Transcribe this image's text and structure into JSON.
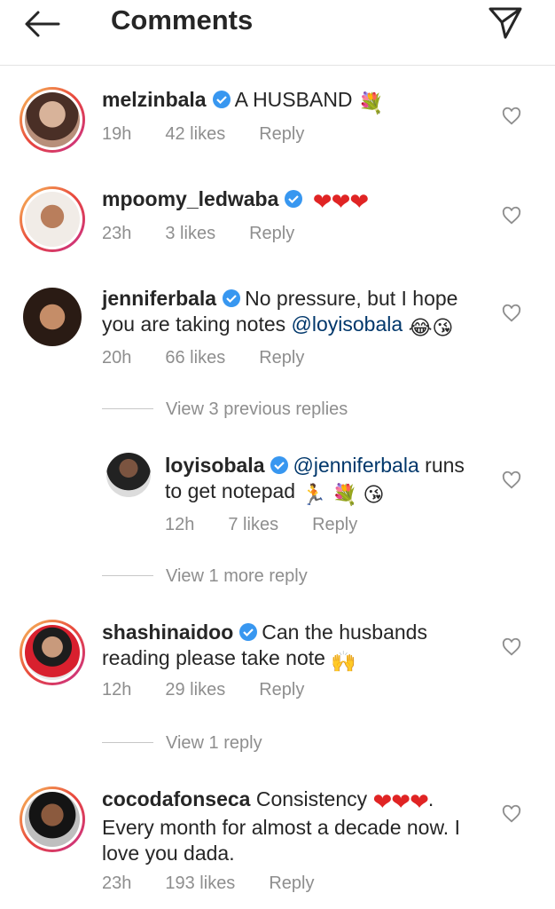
{
  "header": {
    "title": "Comments",
    "back_icon": "arrow-left-icon",
    "share_icon": "paper-plane-icon"
  },
  "comments": [
    {
      "username": "melzinbala",
      "text": "A HUSBAND",
      "emoji": "💐",
      "time": "19h",
      "likes": "42 likes",
      "reply": "Reply",
      "verified": true
    },
    {
      "username": "mpoomy_ledwaba",
      "text": "",
      "emoji": "❤❤❤",
      "time": "23h",
      "likes": "3 likes",
      "reply": "Reply",
      "verified": true
    },
    {
      "username": "jenniferbala",
      "text": "No pressure, but I hope",
      "text2": "you are taking notes",
      "mention": "@loyisobala",
      "emoji": "😂😘",
      "time": "20h",
      "likes": "66 likes",
      "reply": "Reply",
      "verified": true
    },
    {
      "username": "loyisobala",
      "mention": "@jenniferbala",
      "text": "runs",
      "text2": "to get notepad",
      "emoji": "🏃 💐 😘",
      "time": "12h",
      "likes": "7 likes",
      "reply": "Reply",
      "verified": true
    },
    {
      "username": "shashinaidoo",
      "text": "Can the husbands",
      "text2": "reading please take note",
      "emoji": "🙌",
      "time": "12h",
      "likes": "29 likes",
      "reply": "Reply",
      "verified": true
    },
    {
      "username": "cocodafonseca",
      "text": "Consistency",
      "hearts": "❤❤❤",
      "dot": ".",
      "text2": "Every month for almost a decade now. I",
      "text3": "love you dada.",
      "time": "23h",
      "likes": "193 likes",
      "reply": "Reply",
      "verified": false
    }
  ],
  "view_replies": [
    "View 3 previous replies",
    "View 1 more reply",
    "View 1 reply"
  ],
  "colors": {
    "text": "#262626",
    "secondary": "#8e8e8e",
    "mention": "#00376b",
    "verified": "#3897f0",
    "heart": "#e02424"
  }
}
